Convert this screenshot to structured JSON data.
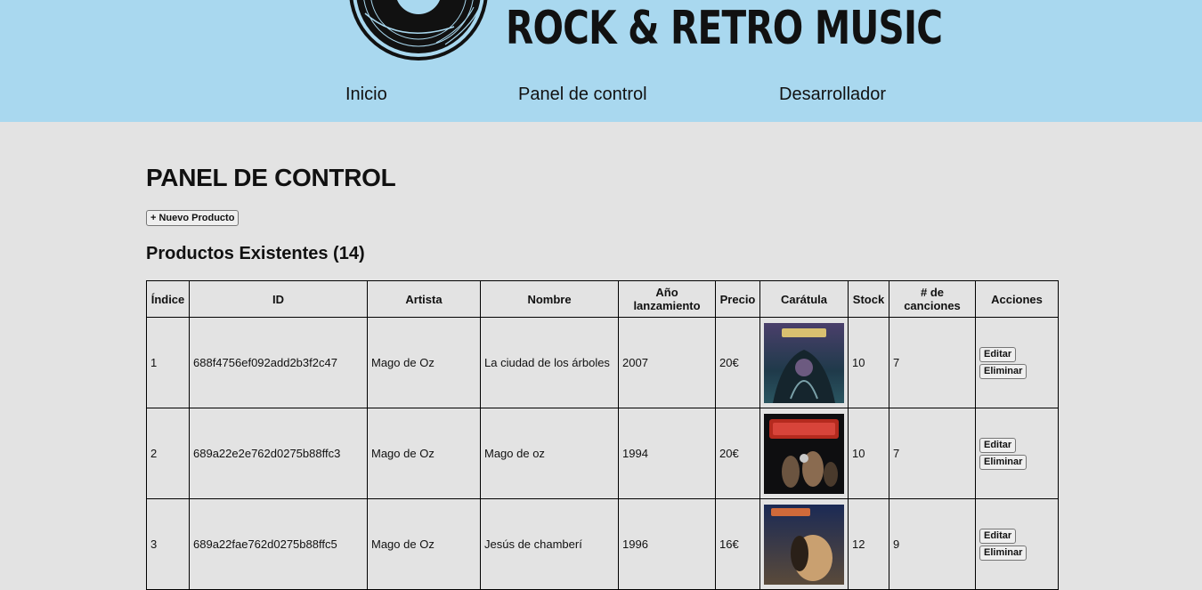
{
  "brand": {
    "title": "ROCK & RETRO MUSIC",
    "logo_icon": "vinyl-record-icon"
  },
  "nav": {
    "items": [
      {
        "label": "Inicio"
      },
      {
        "label": "Panel de control"
      },
      {
        "label": "Desarrollador"
      }
    ]
  },
  "page": {
    "title": "PANEL DE CONTROL",
    "new_product_label": "+ Nuevo Producto",
    "section_title": "Productos Existentes (14)"
  },
  "table": {
    "headers": [
      "Índice",
      "ID",
      "Artista",
      "Nombre",
      "Año lanzamiento",
      "Precio",
      "Carátula",
      "Stock",
      "# de canciones",
      "Acciones"
    ],
    "edit_label": "Editar",
    "delete_label": "Eliminar",
    "rows": [
      {
        "index": "1",
        "id": "688f4756ef092add2b3f2c47",
        "artist": "Mago de Oz",
        "name": "La ciudad de los árboles",
        "year": "2007",
        "price": "20€",
        "stock": "10",
        "songs": "7",
        "cover_colors": [
          "#1f3a4a",
          "#4a3f6b",
          "#2a5560"
        ]
      },
      {
        "index": "2",
        "id": "689a22e2e762d0275b88ffc3",
        "artist": "Mago de Oz",
        "name": "Mago de oz",
        "year": "1994",
        "price": "20€",
        "stock": "10",
        "songs": "7",
        "cover_colors": [
          "#0e0e10",
          "#3b2a22",
          "#b52a1e"
        ]
      },
      {
        "index": "3",
        "id": "689a22fae762d0275b88ffc5",
        "artist": "Mago de Oz",
        "name": "Jesús de chamberí",
        "year": "1996",
        "price": "16€",
        "stock": "12",
        "songs": "9",
        "cover_colors": [
          "#1b2a55",
          "#5a4a3a",
          "#c9a070"
        ]
      }
    ]
  }
}
